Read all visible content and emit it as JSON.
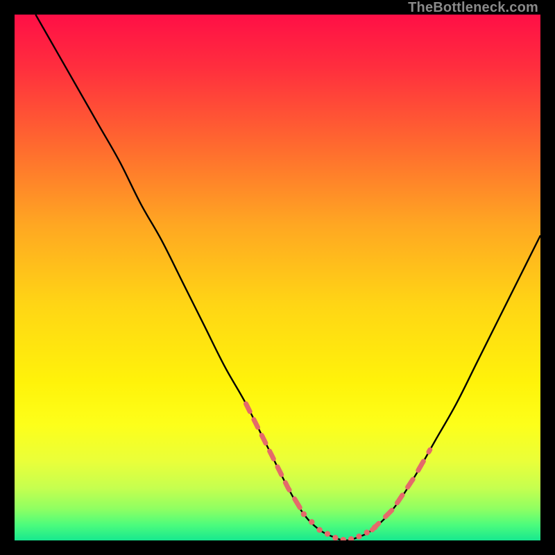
{
  "watermark": "TheBottleneck.com",
  "gradient": {
    "stops": [
      {
        "offset": 0.0,
        "color": "#ff0f46"
      },
      {
        "offset": 0.1,
        "color": "#ff2e3e"
      },
      {
        "offset": 0.25,
        "color": "#ff6a2f"
      },
      {
        "offset": 0.4,
        "color": "#ffa722"
      },
      {
        "offset": 0.55,
        "color": "#ffd515"
      },
      {
        "offset": 0.7,
        "color": "#fff30a"
      },
      {
        "offset": 0.78,
        "color": "#fdff1a"
      },
      {
        "offset": 0.85,
        "color": "#e9ff3a"
      },
      {
        "offset": 0.9,
        "color": "#c6ff4f"
      },
      {
        "offset": 0.94,
        "color": "#8fff62"
      },
      {
        "offset": 0.97,
        "color": "#4dfc7c"
      },
      {
        "offset": 1.0,
        "color": "#17e88f"
      }
    ]
  },
  "chart_data": {
    "type": "line",
    "title": "",
    "xlabel": "",
    "ylabel": "",
    "xlim": [
      0,
      100
    ],
    "ylim": [
      0,
      100
    ],
    "series": [
      {
        "name": "bottleneck-curve",
        "x": [
          4,
          8,
          12,
          16,
          20,
          24,
          28,
          32,
          36,
          40,
          44,
          48,
          52,
          55,
          58,
          61,
          63,
          65,
          68,
          72,
          76,
          80,
          84,
          88,
          92,
          96,
          100
        ],
        "values": [
          100,
          93,
          86,
          79,
          72,
          64,
          57,
          49,
          41,
          33,
          26,
          18,
          10,
          5,
          2,
          0.5,
          0,
          0.5,
          2,
          6,
          12,
          19,
          26,
          34,
          42,
          50,
          58
        ]
      }
    ],
    "highlight_segments": [
      {
        "name": "left-dashes",
        "x_range": [
          44,
          55
        ]
      },
      {
        "name": "right-dashes",
        "x_range": [
          68,
          79
        ]
      }
    ],
    "near_zero_dots_x": [
      55,
      56.5,
      58,
      59.5,
      61,
      62.5,
      64,
      65.5,
      67,
      68.5
    ],
    "colors": {
      "curve": "#000000",
      "dash": "#e46a6a",
      "dot": "#e46a6a"
    }
  }
}
